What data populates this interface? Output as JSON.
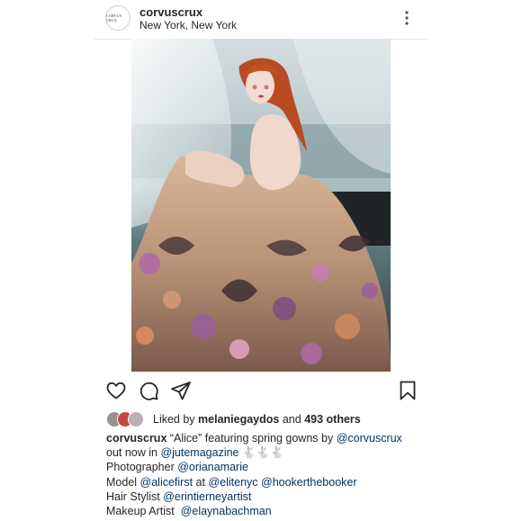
{
  "post": {
    "avatar_text": "CORVUS CRUX",
    "username": "corvuscrux",
    "location": "New York, New York",
    "more_icon": "more-vertical-icon"
  },
  "actions": {
    "like_icon": "heart-icon",
    "comment_icon": "comment-icon",
    "share_icon": "paper-plane-icon",
    "save_icon": "bookmark-icon"
  },
  "likes": {
    "prefix": "Liked by",
    "user": "melaniegaydos",
    "and": "and",
    "others": "493 others"
  },
  "caption": {
    "username": "corvuscrux",
    "text1": " “Alice” featuring spring gowns by ",
    "tag1": "@corvuscrux",
    "text2": "out now in ",
    "tag2": "@jutemagazine",
    "emoji": " 🐇🐇🐇",
    "photographer_label": "Photographer ",
    "photographer": "@orianamarie",
    "model_label": "Model ",
    "model": "@alicefirst",
    "at": " at ",
    "agency1": "@elitenyc",
    "agency2": "@hookerthebooker",
    "hair_label": "Hair Stylist ",
    "hair": "@erintierneyartist",
    "makeup_label": "Makeup Artist  ",
    "makeup": "@elaynabachman"
  },
  "colors": {
    "text": "#262626",
    "tag": "#003569",
    "divider": "#e6e6e6"
  }
}
